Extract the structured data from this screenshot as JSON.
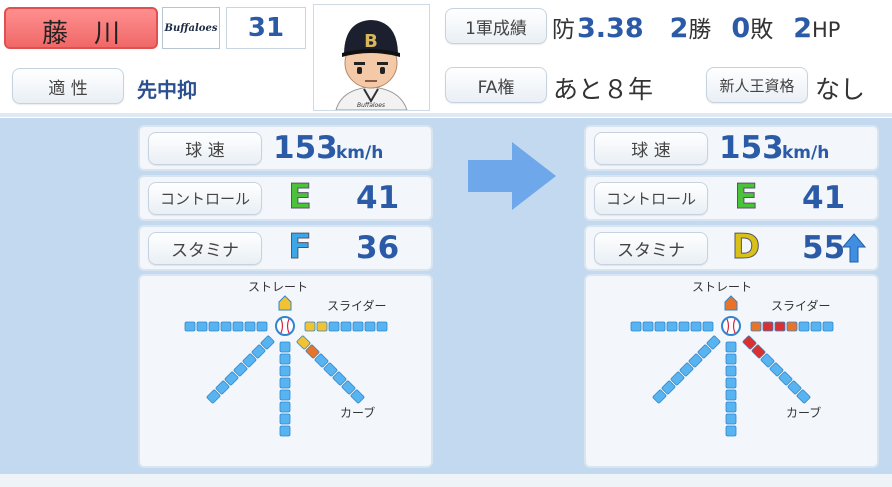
{
  "header": {
    "player_name": "藤　川",
    "team_logo_text": "Buffaloes",
    "uniform_number": "31",
    "aptitude_label": "適 性",
    "aptitude_value": "先中抑",
    "stats_label": "1軍成績",
    "era_label": "防",
    "era_value": "3.38",
    "wins_value": "2",
    "wins_label": "勝",
    "losses_value": "0",
    "losses_label": "敗",
    "holds_value": "2",
    "holds_label": "HP",
    "fa_label": "FA権",
    "fa_value": "あと８年",
    "rookie_label": "新人王資格",
    "rookie_value": "なし"
  },
  "before": {
    "velocity_label": "球 速",
    "velocity_value": "153",
    "velocity_unit": "km/h",
    "control_label": "コントロール",
    "control_grade": "E",
    "control_value": "41",
    "stamina_label": "スタミナ",
    "stamina_grade": "F",
    "stamina_value": "36"
  },
  "after": {
    "velocity_label": "球 速",
    "velocity_value": "153",
    "velocity_unit": "km/h",
    "control_label": "コントロール",
    "control_grade": "E",
    "control_value": "41",
    "stamina_label": "スタミナ",
    "stamina_grade": "D",
    "stamina_value": "55"
  },
  "pitch_chart": {
    "straight_label": "ストレート",
    "slider_label": "スライダー",
    "curve_label": "カーブ"
  },
  "colors": {
    "grade_E": "#4cc23a",
    "grade_F": "#3ba7e8",
    "grade_D": "#d8c21a",
    "name_plate": "#f47a7a",
    "background_blue": "#c3d9f0",
    "arrow_blue": "#6ea8ea",
    "up_arrow": "#3f8ee0"
  },
  "icons": [
    "player-portrait",
    "team-logo",
    "transition-arrow-icon",
    "up-arrow-icon",
    "baseball-icon"
  ]
}
